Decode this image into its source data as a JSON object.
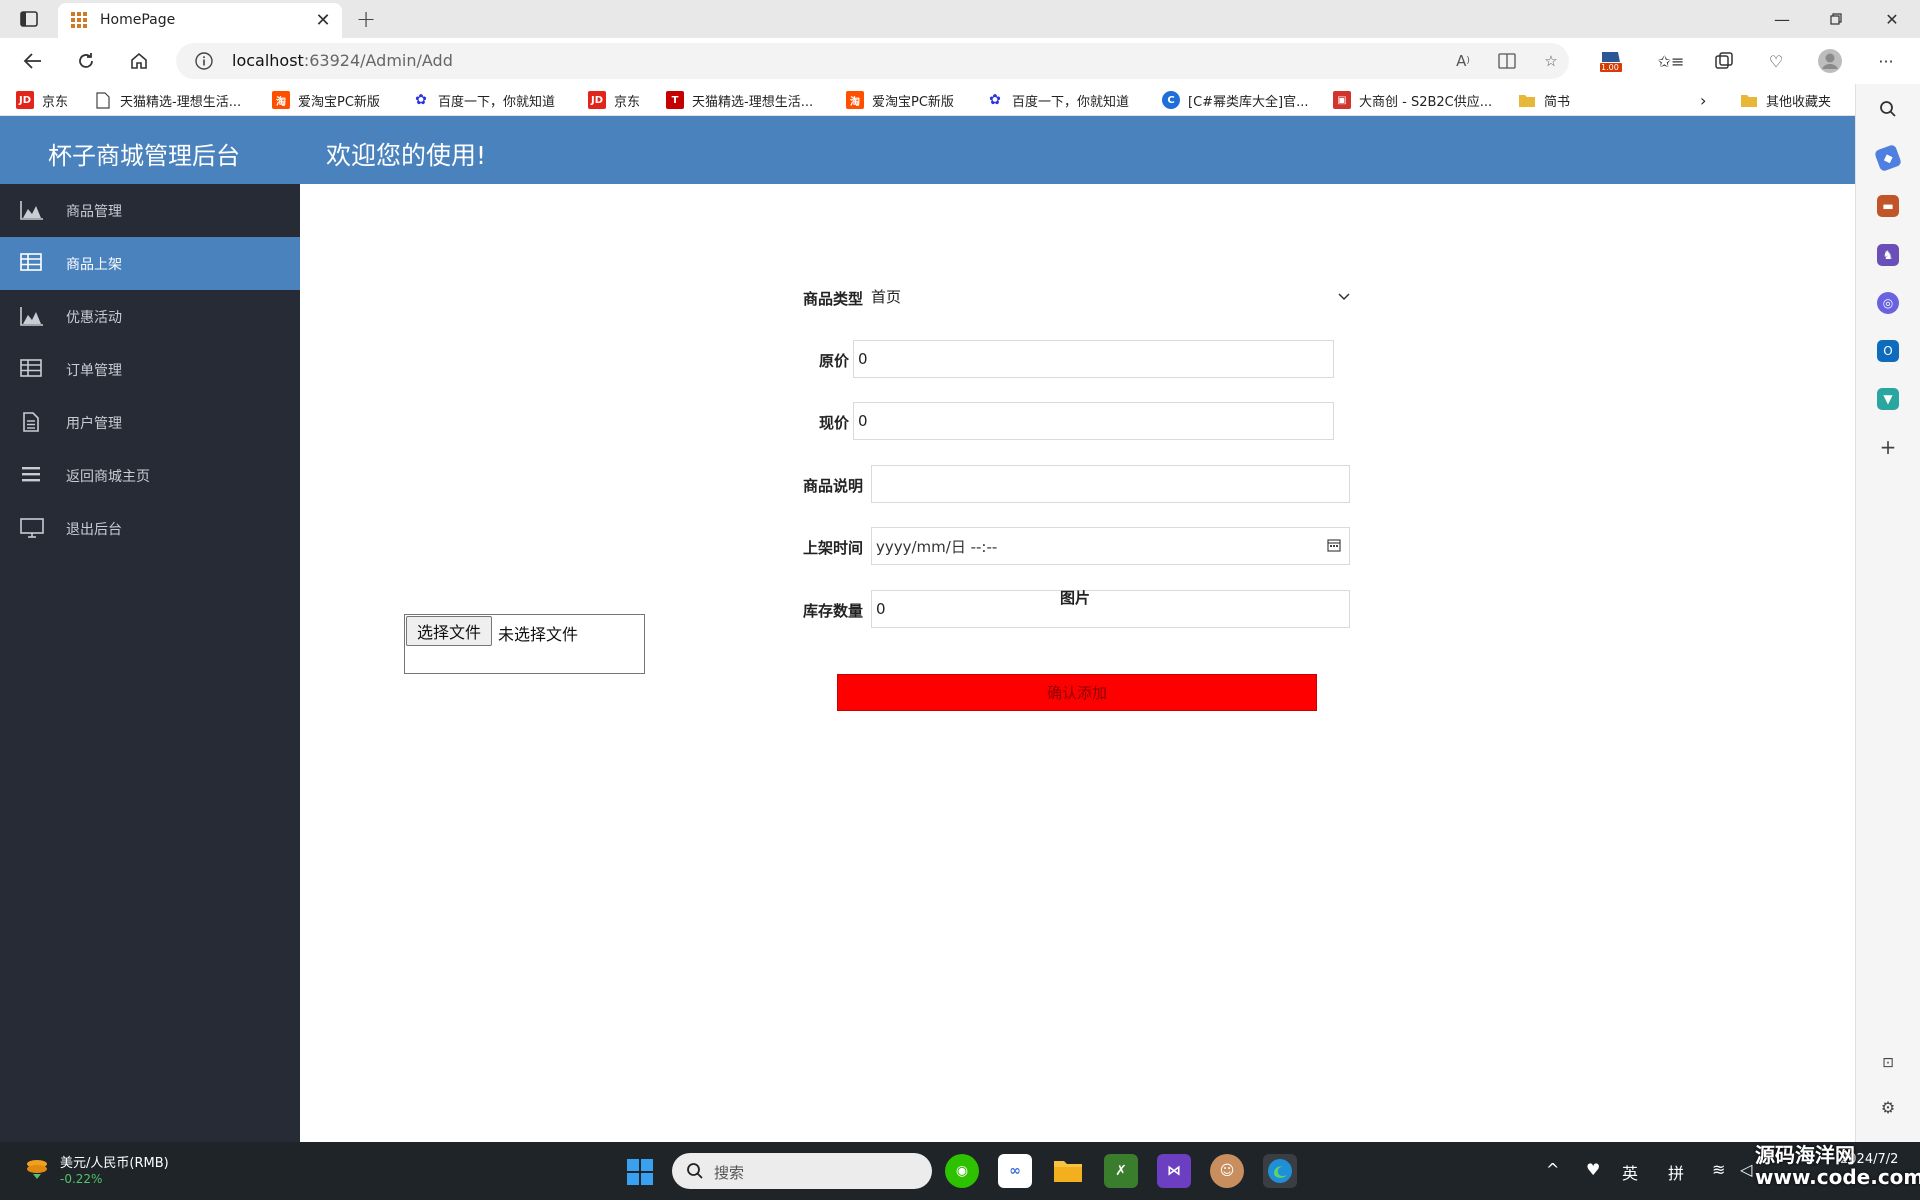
{
  "browser": {
    "tab_title": "HomePage",
    "url_host": "localhost",
    "url_rest": ":63924/Admin/Add",
    "zoom_badge": "1.00",
    "favorites": [
      {
        "label": "京东",
        "icon": "JD",
        "color": "#e1251b"
      },
      {
        "label": "天猫精选-理想生活...",
        "icon": "page",
        "color": "#555555"
      },
      {
        "label": "爱淘宝PC新版",
        "icon": "淘",
        "color": "#ff5000"
      },
      {
        "label": "百度一下，你就知道",
        "icon": "paw",
        "color": "#2932e1"
      },
      {
        "label": "京东",
        "icon": "JD",
        "color": "#e1251b"
      },
      {
        "label": "天猫精选-理想生活...",
        "icon": "T",
        "color": "#c40000"
      },
      {
        "label": "爱淘宝PC新版",
        "icon": "淘",
        "color": "#ff5000"
      },
      {
        "label": "百度一下，你就知道",
        "icon": "paw",
        "color": "#2932e1"
      },
      {
        "label": "[C#幂类库大全]官...",
        "icon": "C",
        "color": "#1e6fd9"
      },
      {
        "label": "大商创 - S2B2C供应...",
        "icon": "box",
        "color": "#d0342c"
      },
      {
        "label": "简书",
        "icon": "folder",
        "color": "#e8b73a"
      }
    ],
    "favorites_more": "其他收藏夹"
  },
  "site": {
    "logo": "杯子商城管理后台",
    "welcome": "欢迎您的使用!",
    "header_color": "#4a82bd",
    "sidebar_color": "#262b36",
    "nav": [
      {
        "label": "商品管理",
        "icon": "area-chart-icon",
        "active": false
      },
      {
        "label": "商品上架",
        "icon": "table-icon",
        "active": true
      },
      {
        "label": "优惠活动",
        "icon": "area-chart-icon",
        "active": false
      },
      {
        "label": "订单管理",
        "icon": "table-icon",
        "active": false
      },
      {
        "label": "用户管理",
        "icon": "document-icon",
        "active": false
      },
      {
        "label": "返回商城主页",
        "icon": "list-icon",
        "active": false
      },
      {
        "label": "退出后台",
        "icon": "monitor-icon",
        "active": false
      }
    ]
  },
  "form": {
    "category_label": "商品类型",
    "category_value": "首页",
    "orig_price_label": "原价",
    "orig_price_value": "0",
    "cur_price_label": "现价",
    "cur_price_value": "0",
    "desc_label": "商品说明",
    "desc_value": "",
    "time_label": "上架时间",
    "time_placeholder": "yyyy/mm/日 --:--",
    "stock_label": "库存数量",
    "stock_value": "0",
    "image_label": "图片",
    "file_button": "选择文件",
    "file_status": "未选择文件",
    "submit_label": "确认添加",
    "submit_color": "#ff0000"
  },
  "taskbar": {
    "fx_title": "美元/人民币(RMB)",
    "fx_change": "-0.22%",
    "search_placeholder": "搜索",
    "ime_lang": "英",
    "ime_mode": "拼",
    "clock": "2024/7/2"
  },
  "watermark": "源码海洋网 www.code.com"
}
